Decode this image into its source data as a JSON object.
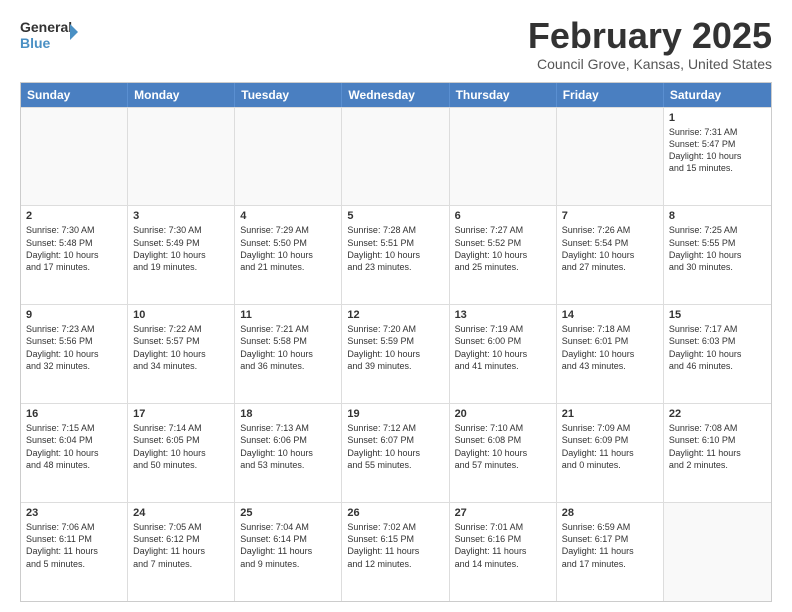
{
  "header": {
    "logo_general": "General",
    "logo_blue": "Blue",
    "month": "February 2025",
    "location": "Council Grove, Kansas, United States"
  },
  "days": [
    "Sunday",
    "Monday",
    "Tuesday",
    "Wednesday",
    "Thursday",
    "Friday",
    "Saturday"
  ],
  "rows": [
    [
      {
        "day": "",
        "text": "",
        "empty": true
      },
      {
        "day": "",
        "text": "",
        "empty": true
      },
      {
        "day": "",
        "text": "",
        "empty": true
      },
      {
        "day": "",
        "text": "",
        "empty": true
      },
      {
        "day": "",
        "text": "",
        "empty": true
      },
      {
        "day": "",
        "text": "",
        "empty": true
      },
      {
        "day": "1",
        "text": "Sunrise: 7:31 AM\nSunset: 5:47 PM\nDaylight: 10 hours\nand 15 minutes.",
        "empty": false
      }
    ],
    [
      {
        "day": "2",
        "text": "Sunrise: 7:30 AM\nSunset: 5:48 PM\nDaylight: 10 hours\nand 17 minutes.",
        "empty": false
      },
      {
        "day": "3",
        "text": "Sunrise: 7:30 AM\nSunset: 5:49 PM\nDaylight: 10 hours\nand 19 minutes.",
        "empty": false
      },
      {
        "day": "4",
        "text": "Sunrise: 7:29 AM\nSunset: 5:50 PM\nDaylight: 10 hours\nand 21 minutes.",
        "empty": false
      },
      {
        "day": "5",
        "text": "Sunrise: 7:28 AM\nSunset: 5:51 PM\nDaylight: 10 hours\nand 23 minutes.",
        "empty": false
      },
      {
        "day": "6",
        "text": "Sunrise: 7:27 AM\nSunset: 5:52 PM\nDaylight: 10 hours\nand 25 minutes.",
        "empty": false
      },
      {
        "day": "7",
        "text": "Sunrise: 7:26 AM\nSunset: 5:54 PM\nDaylight: 10 hours\nand 27 minutes.",
        "empty": false
      },
      {
        "day": "8",
        "text": "Sunrise: 7:25 AM\nSunset: 5:55 PM\nDaylight: 10 hours\nand 30 minutes.",
        "empty": false
      }
    ],
    [
      {
        "day": "9",
        "text": "Sunrise: 7:23 AM\nSunset: 5:56 PM\nDaylight: 10 hours\nand 32 minutes.",
        "empty": false
      },
      {
        "day": "10",
        "text": "Sunrise: 7:22 AM\nSunset: 5:57 PM\nDaylight: 10 hours\nand 34 minutes.",
        "empty": false
      },
      {
        "day": "11",
        "text": "Sunrise: 7:21 AM\nSunset: 5:58 PM\nDaylight: 10 hours\nand 36 minutes.",
        "empty": false
      },
      {
        "day": "12",
        "text": "Sunrise: 7:20 AM\nSunset: 5:59 PM\nDaylight: 10 hours\nand 39 minutes.",
        "empty": false
      },
      {
        "day": "13",
        "text": "Sunrise: 7:19 AM\nSunset: 6:00 PM\nDaylight: 10 hours\nand 41 minutes.",
        "empty": false
      },
      {
        "day": "14",
        "text": "Sunrise: 7:18 AM\nSunset: 6:01 PM\nDaylight: 10 hours\nand 43 minutes.",
        "empty": false
      },
      {
        "day": "15",
        "text": "Sunrise: 7:17 AM\nSunset: 6:03 PM\nDaylight: 10 hours\nand 46 minutes.",
        "empty": false
      }
    ],
    [
      {
        "day": "16",
        "text": "Sunrise: 7:15 AM\nSunset: 6:04 PM\nDaylight: 10 hours\nand 48 minutes.",
        "empty": false
      },
      {
        "day": "17",
        "text": "Sunrise: 7:14 AM\nSunset: 6:05 PM\nDaylight: 10 hours\nand 50 minutes.",
        "empty": false
      },
      {
        "day": "18",
        "text": "Sunrise: 7:13 AM\nSunset: 6:06 PM\nDaylight: 10 hours\nand 53 minutes.",
        "empty": false
      },
      {
        "day": "19",
        "text": "Sunrise: 7:12 AM\nSunset: 6:07 PM\nDaylight: 10 hours\nand 55 minutes.",
        "empty": false
      },
      {
        "day": "20",
        "text": "Sunrise: 7:10 AM\nSunset: 6:08 PM\nDaylight: 10 hours\nand 57 minutes.",
        "empty": false
      },
      {
        "day": "21",
        "text": "Sunrise: 7:09 AM\nSunset: 6:09 PM\nDaylight: 11 hours\nand 0 minutes.",
        "empty": false
      },
      {
        "day": "22",
        "text": "Sunrise: 7:08 AM\nSunset: 6:10 PM\nDaylight: 11 hours\nand 2 minutes.",
        "empty": false
      }
    ],
    [
      {
        "day": "23",
        "text": "Sunrise: 7:06 AM\nSunset: 6:11 PM\nDaylight: 11 hours\nand 5 minutes.",
        "empty": false
      },
      {
        "day": "24",
        "text": "Sunrise: 7:05 AM\nSunset: 6:12 PM\nDaylight: 11 hours\nand 7 minutes.",
        "empty": false
      },
      {
        "day": "25",
        "text": "Sunrise: 7:04 AM\nSunset: 6:14 PM\nDaylight: 11 hours\nand 9 minutes.",
        "empty": false
      },
      {
        "day": "26",
        "text": "Sunrise: 7:02 AM\nSunset: 6:15 PM\nDaylight: 11 hours\nand 12 minutes.",
        "empty": false
      },
      {
        "day": "27",
        "text": "Sunrise: 7:01 AM\nSunset: 6:16 PM\nDaylight: 11 hours\nand 14 minutes.",
        "empty": false
      },
      {
        "day": "28",
        "text": "Sunrise: 6:59 AM\nSunset: 6:17 PM\nDaylight: 11 hours\nand 17 minutes.",
        "empty": false
      },
      {
        "day": "",
        "text": "",
        "empty": true
      }
    ]
  ]
}
